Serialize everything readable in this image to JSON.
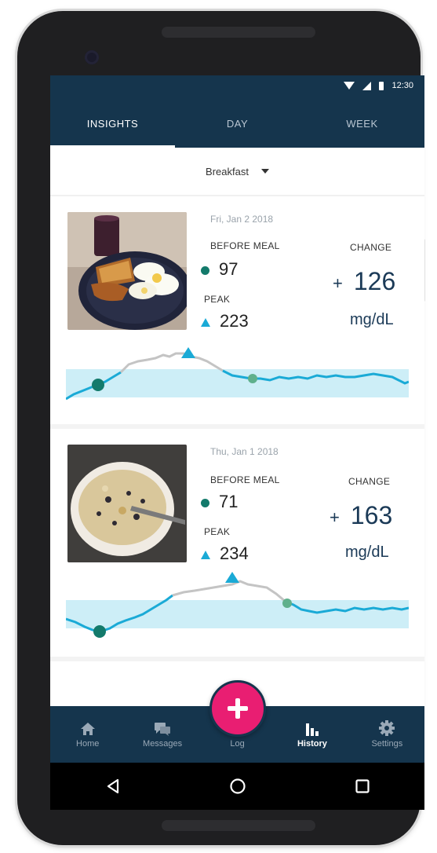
{
  "status": {
    "time": "12:30"
  },
  "tabs": [
    {
      "label": "INSIGHTS",
      "active": true
    },
    {
      "label": "DAY",
      "active": false
    },
    {
      "label": "WEEK",
      "active": false
    }
  ],
  "filter": {
    "selected": "Breakfast"
  },
  "meals": [
    {
      "date": "Fri, Jan 2 2018",
      "before_label": "BEFORE MEAL",
      "before_value": "97",
      "peak_label": "PEAK",
      "peak_value": "223",
      "change_label": "CHANGE",
      "change_sign": "+",
      "change_value": "126",
      "unit": "mg/dL",
      "photo": "toast-and-eggs-plate"
    },
    {
      "date": "Thu, Jan 1 2018",
      "before_label": "BEFORE MEAL",
      "before_value": "71",
      "peak_label": "PEAK",
      "peak_value": "234",
      "change_label": "CHANGE",
      "change_sign": "+",
      "change_value": "163",
      "unit": "mg/dL",
      "photo": "oatmeal-bowl"
    }
  ],
  "nav": [
    {
      "label": "Home",
      "icon": "home-icon",
      "active": false
    },
    {
      "label": "Messages",
      "icon": "messages-icon",
      "active": false
    },
    {
      "label": "Log",
      "icon": "plus-icon",
      "active": false
    },
    {
      "label": "History",
      "icon": "bar-chart-icon",
      "active": true
    },
    {
      "label": "Settings",
      "icon": "gear-icon",
      "active": false
    }
  ],
  "colors": {
    "header": "#15354d",
    "accent": "#e91e72",
    "line": "#1aaad6",
    "band": "#cdeef7",
    "before_dot": "#137a6b",
    "after_dot": "#5fb08c"
  }
}
